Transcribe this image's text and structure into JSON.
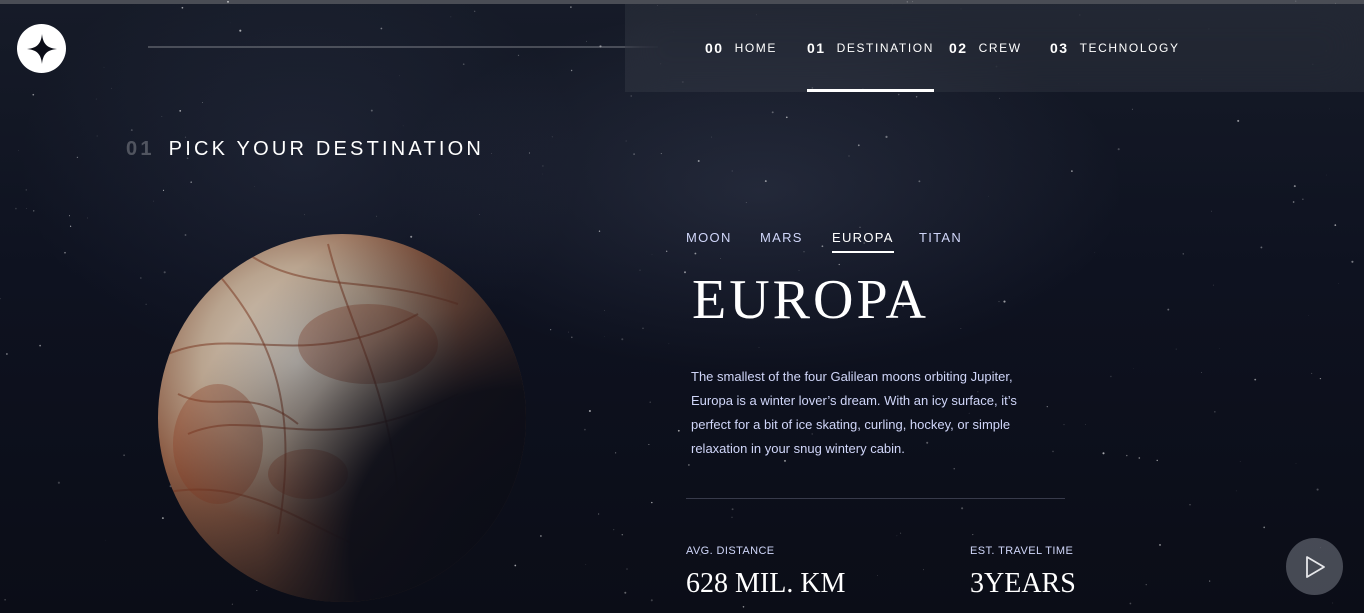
{
  "brand": {
    "logo_icon": "star-logo-icon"
  },
  "nav": {
    "items": [
      {
        "num": "00",
        "label": "HOME",
        "active": false
      },
      {
        "num": "01",
        "label": "DESTINATION",
        "active": true
      },
      {
        "num": "02",
        "label": "CREW",
        "active": false
      },
      {
        "num": "03",
        "label": "TECHNOLOGY",
        "active": false
      }
    ]
  },
  "heading": {
    "num": "01",
    "text": "PICK YOUR DESTINATION"
  },
  "tabs": [
    {
      "label": "MOON",
      "active": false
    },
    {
      "label": "MARS",
      "active": false
    },
    {
      "label": "EUROPA",
      "active": true
    },
    {
      "label": "TITAN",
      "active": false
    }
  ],
  "destination": {
    "name": "EUROPA",
    "description": "The smallest of the four Galilean moons orbiting Jupiter, Europa is a winter lover’s dream. With an icy surface, it’s perfect for a bit of ice skating, curling, hockey, or simple relaxation in your snug wintery cabin.",
    "stats": {
      "distance_label": "AVG. DISTANCE",
      "distance_value": "628 MIL. KM",
      "travel_label": "EST. TRAVEL TIME",
      "travel_value": "3YEARS"
    }
  },
  "controls": {
    "play_icon": "play-icon"
  },
  "colors": {
    "background": "#0b0d17",
    "text_light": "#d0d6f9",
    "white": "#ffffff"
  }
}
